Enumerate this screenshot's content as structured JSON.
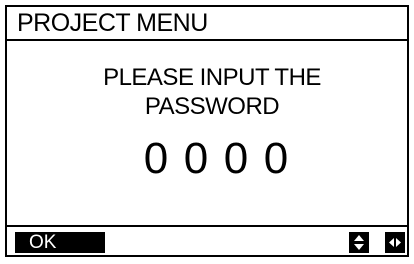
{
  "header": {
    "title": "PROJECT MENU"
  },
  "prompt": {
    "line1": "PLEASE INPUT THE",
    "line2": "PASSWORD"
  },
  "password": {
    "digits": [
      "0",
      "0",
      "0",
      "0"
    ]
  },
  "footer": {
    "ok_label": "OK",
    "icons": [
      "up-down-arrow-icon",
      "left-right-arrow-icon"
    ]
  }
}
